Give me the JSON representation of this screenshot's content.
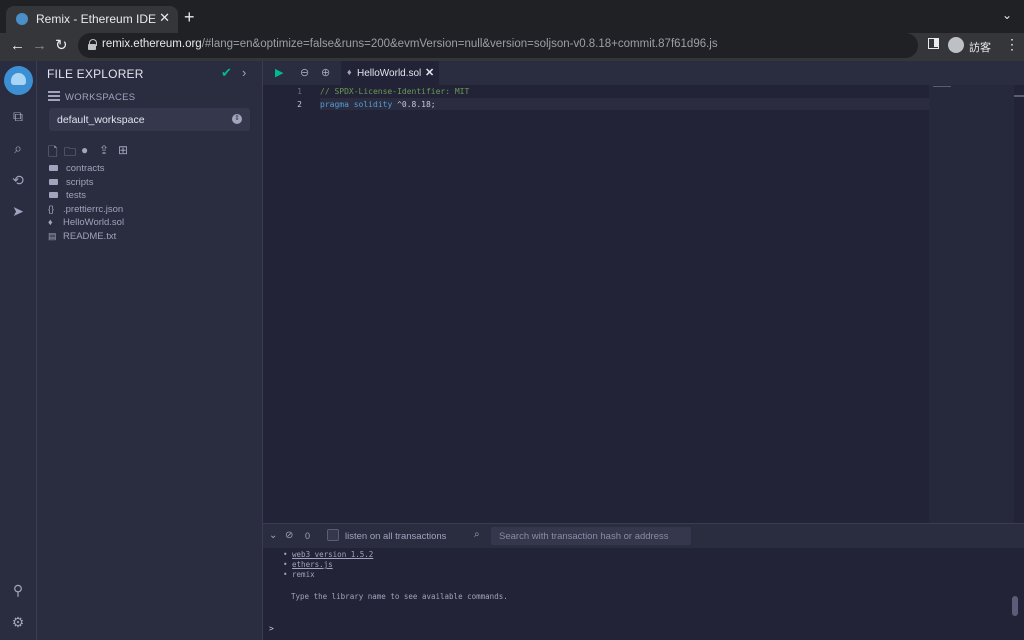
{
  "browser": {
    "tab_title": "Remix - Ethereum IDE",
    "tab_close": "✕",
    "new_tab": "+",
    "url_host": "remix.ethereum.org",
    "url_rest": "/#lang=en&optimize=false&runs=200&evmVersion=null&version=soljson-v0.8.18+commit.87f61d96.js",
    "profile_name": "訪客"
  },
  "sidebar": {
    "title": "FILE EXPLORER",
    "workspaces_label": "WORKSPACES",
    "workspace_selected": "default_workspace",
    "tree": [
      {
        "type": "folder",
        "name": "contracts"
      },
      {
        "type": "folder",
        "name": "scripts"
      },
      {
        "type": "folder",
        "name": "tests"
      },
      {
        "type": "json",
        "name": ".prettierrc.json"
      },
      {
        "type": "sol",
        "name": "HelloWorld.sol"
      },
      {
        "type": "txt",
        "name": "README.txt"
      }
    ]
  },
  "editor": {
    "active_tab": "HelloWorld.sol",
    "line_numbers": [
      "1",
      "2"
    ],
    "line1": "// SPDX-License-Identifier: MIT",
    "line2_kw1": "pragma",
    "line2_kw2": "solidity",
    "line2_rest": "^0.8.18;"
  },
  "terminal": {
    "pending_count": "0",
    "listen_label": "listen on all transactions",
    "search_placeholder": "Search with transaction hash or address",
    "lines": [
      "web3 version 1.5.2",
      "ethers.js",
      "remix"
    ],
    "help": "Type the library name to see available commands.",
    "prompt": ">"
  },
  "colors": {
    "accent_green": "#00bc8c",
    "bg": "#222336",
    "panel": "#2a2c3f"
  }
}
